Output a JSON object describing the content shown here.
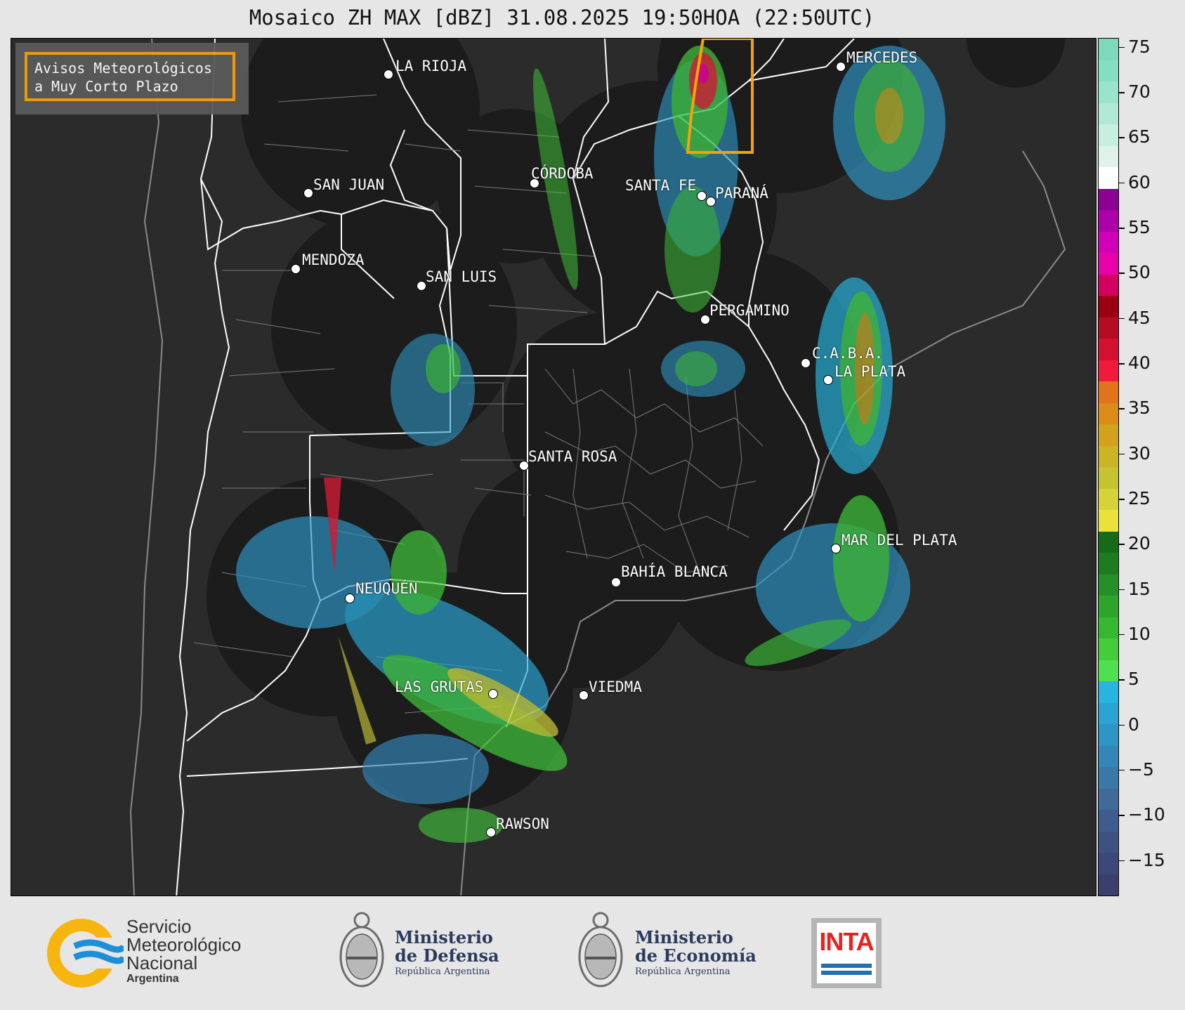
{
  "title": "Mosaico ZH MAX [dBZ] 31.08.2025 19:50HOA (22:50UTC)",
  "alert": {
    "line1": "Avisos Meteorológicos",
    "line2": "a Muy Corto Plazo",
    "color": "#f5a10b"
  },
  "cities": [
    {
      "name": "LA RIOJA"
    },
    {
      "name": "CÓRDOBA"
    },
    {
      "name": "SAN JUAN"
    },
    {
      "name": "SANTA FE"
    },
    {
      "name": "PARANÁ"
    },
    {
      "name": "MERCEDES"
    },
    {
      "name": "MENDOZA"
    },
    {
      "name": "SAN LUIS"
    },
    {
      "name": "PERGAMINO"
    },
    {
      "name": "C.A.B.A."
    },
    {
      "name": "LA PLATA"
    },
    {
      "name": "SANTA ROSA"
    },
    {
      "name": "MAR DEL PLATA"
    },
    {
      "name": "NEUQUÉN"
    },
    {
      "name": "BAHÍA BLANCA"
    },
    {
      "name": "LAS GRUTAS"
    },
    {
      "name": "VIEDMA"
    },
    {
      "name": "RAWSON"
    }
  ],
  "colorbar": {
    "unit": "dBZ",
    "min": -19,
    "max": 76,
    "ticks": [
      "75",
      "70",
      "65",
      "60",
      "55",
      "50",
      "45",
      "40",
      "35",
      "30",
      "25",
      "20",
      "15",
      "10",
      "5",
      "0",
      "−5",
      "−10",
      "−15"
    ],
    "colors": [
      "#3a3f6e",
      "#3c4878",
      "#3d5283",
      "#3e5d8e",
      "#3f6a9a",
      "#3a78a8",
      "#3486b6",
      "#2e95c4",
      "#2aa4d2",
      "#27b4de",
      "#4fe04f",
      "#43cc3c",
      "#37b832",
      "#2ea42c",
      "#268f27",
      "#1e7b20",
      "#186a1b",
      "#e8e23a",
      "#d6d33a",
      "#c6c332",
      "#c9b526",
      "#d2a11e",
      "#db8b18",
      "#e2731a",
      "#f01a3a",
      "#d21030",
      "#b40c20",
      "#9a0012",
      "#d40060",
      "#e800a8",
      "#d000b8",
      "#ac00a8",
      "#8c0094",
      "#ffffff",
      "#dff3ea",
      "#c7efe0",
      "#b0ead6",
      "#99e4cc",
      "#84dfc2",
      "#7cd9bb"
    ]
  },
  "footer": {
    "smn": [
      "Servicio",
      "Meteorológico",
      "Nacional",
      "Argentina"
    ],
    "defensa": [
      "Ministerio",
      "de Defensa",
      "República Argentina"
    ],
    "economia": [
      "Ministerio",
      "de Economía",
      "República Argentina"
    ],
    "inta": "INTA"
  }
}
